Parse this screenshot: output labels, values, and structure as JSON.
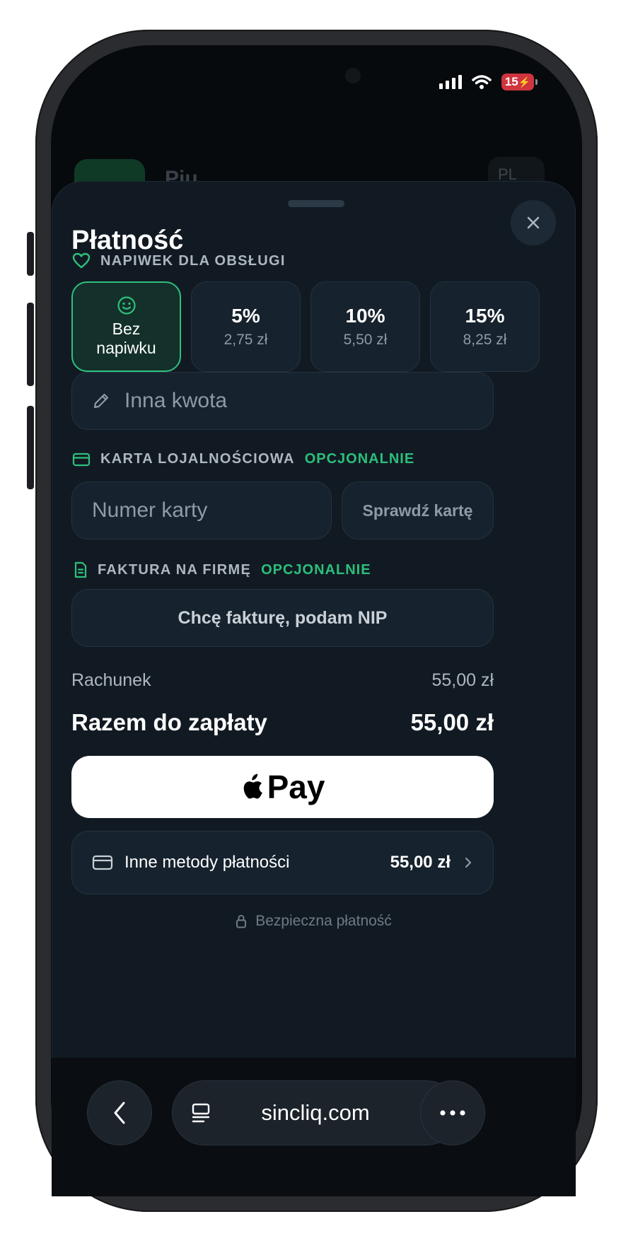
{
  "status_bar": {
    "battery": "15"
  },
  "background_page": {
    "title_partial": "Piu",
    "lang_partial": "PL"
  },
  "sheet": {
    "title": "Płatność",
    "tip_section": {
      "label": "NAPIWEK DLA OBSŁUGI",
      "options": [
        {
          "label": "Bez napiwku",
          "amount": "",
          "selected": true
        },
        {
          "label": "5%",
          "amount": "2,75 zł",
          "selected": false
        },
        {
          "label": "10%",
          "amount": "5,50 zł",
          "selected": false
        },
        {
          "label": "15%",
          "amount": "8,25 zł",
          "selected": false
        }
      ],
      "custom_amount_placeholder": "Inna kwota"
    },
    "loyalty_section": {
      "label": "KARTA LOJALNOŚCIOWA",
      "optional_label": "OPCJONALNIE",
      "card_placeholder": "Numer karty",
      "check_button": "Sprawdź kartę"
    },
    "invoice_section": {
      "label": "FAKTURA NA FIRMĘ",
      "optional_label": "OPCJONALNIE",
      "button": "Chcę fakturę, podam NIP"
    },
    "summary": {
      "bill_label": "Rachunek",
      "bill_value": "55,00 zł",
      "total_label": "Razem do zapłaty",
      "total_value": "55,00 zł"
    },
    "apple_pay_label": "Pay",
    "other_methods": {
      "label": "Inne metody płatności",
      "amount": "55,00 zł"
    },
    "secure_note": "Bezpieczna płatność"
  },
  "browser": {
    "url": "sincliq.com"
  },
  "colors": {
    "accent": "#2fc07c",
    "sheet_bg": "#111a22",
    "field_bg": "#16222d"
  },
  "icons": [
    "heart-icon",
    "smile-icon",
    "pencil-icon",
    "card-icon",
    "document-icon",
    "apple-logo-icon",
    "lock-icon",
    "close-icon",
    "back-icon",
    "reader-icon",
    "reload-icon",
    "more-icon",
    "chevron-right-icon"
  ]
}
